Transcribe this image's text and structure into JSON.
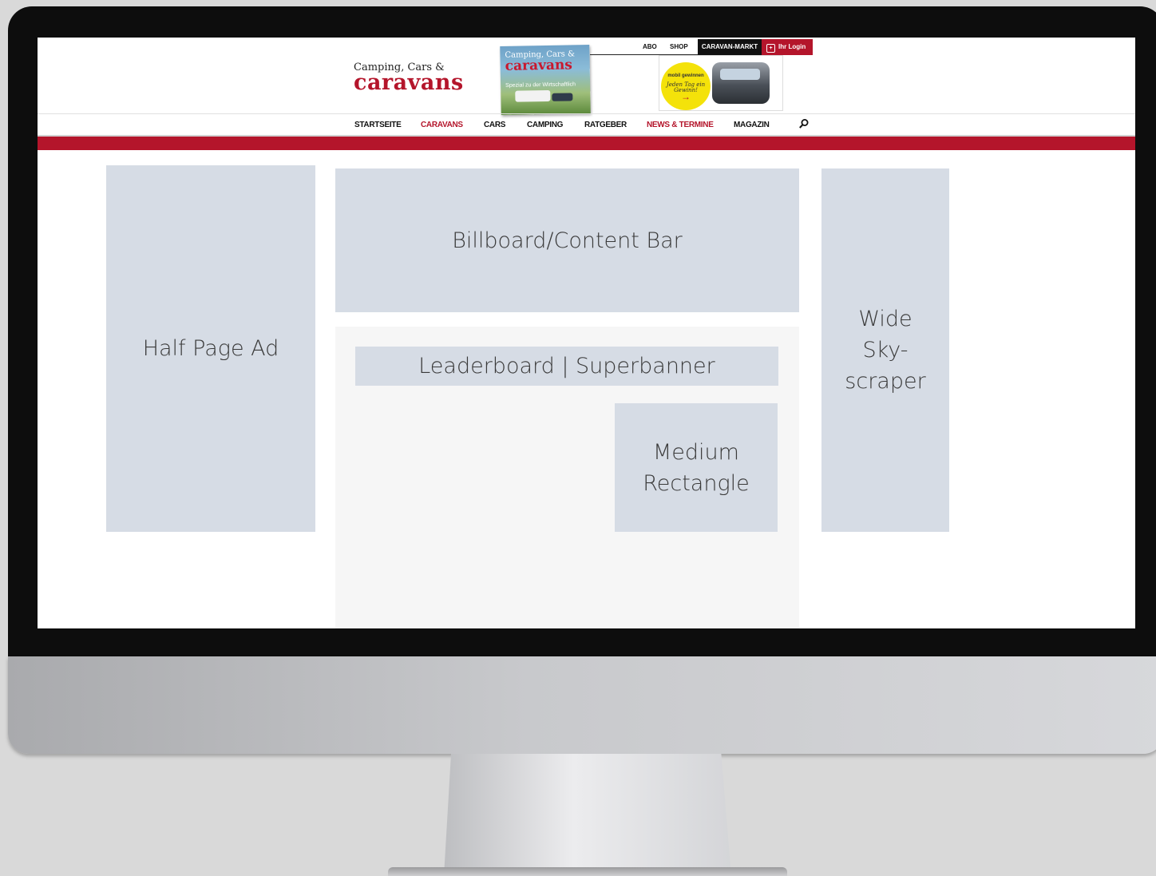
{
  "site": {
    "logo_line1": "Camping, Cars &",
    "logo_line2": "caravans",
    "accent_color": "#b4152b"
  },
  "magazine": {
    "title1": "Camping, Cars &",
    "title2": "caravans",
    "subline": "Spezial zu der Wirtschaftlich"
  },
  "topnav": {
    "abo": "ABO",
    "shop": "SHOP",
    "market": "CARAVAN-MARKT",
    "login": "Ihr Login",
    "login_icon": "login-icon"
  },
  "promo": {
    "line1": "mobil gewinnen",
    "line2": "Jeden Tag ein Gewinn!",
    "arrow": "→"
  },
  "mainnav": {
    "items": [
      {
        "label": "STARTSEITE"
      },
      {
        "label": "CARAVANS"
      },
      {
        "label": "CARS"
      },
      {
        "label": "CAMPING"
      },
      {
        "label": "RATGEBER"
      },
      {
        "label": "NEWS & TERMINE"
      },
      {
        "label": "MAGAZIN"
      }
    ],
    "search_icon": "search-icon"
  },
  "ads": {
    "half_page": "Half Page Ad",
    "billboard": "Billboard/Content Bar",
    "leaderboard": "Leaderboard | Superbanner",
    "medium_rectangle": "Medium\nRectangle",
    "wide_skyscraper": "Wide\nSky-\nscraper",
    "slot_color": "#d6dce5"
  }
}
